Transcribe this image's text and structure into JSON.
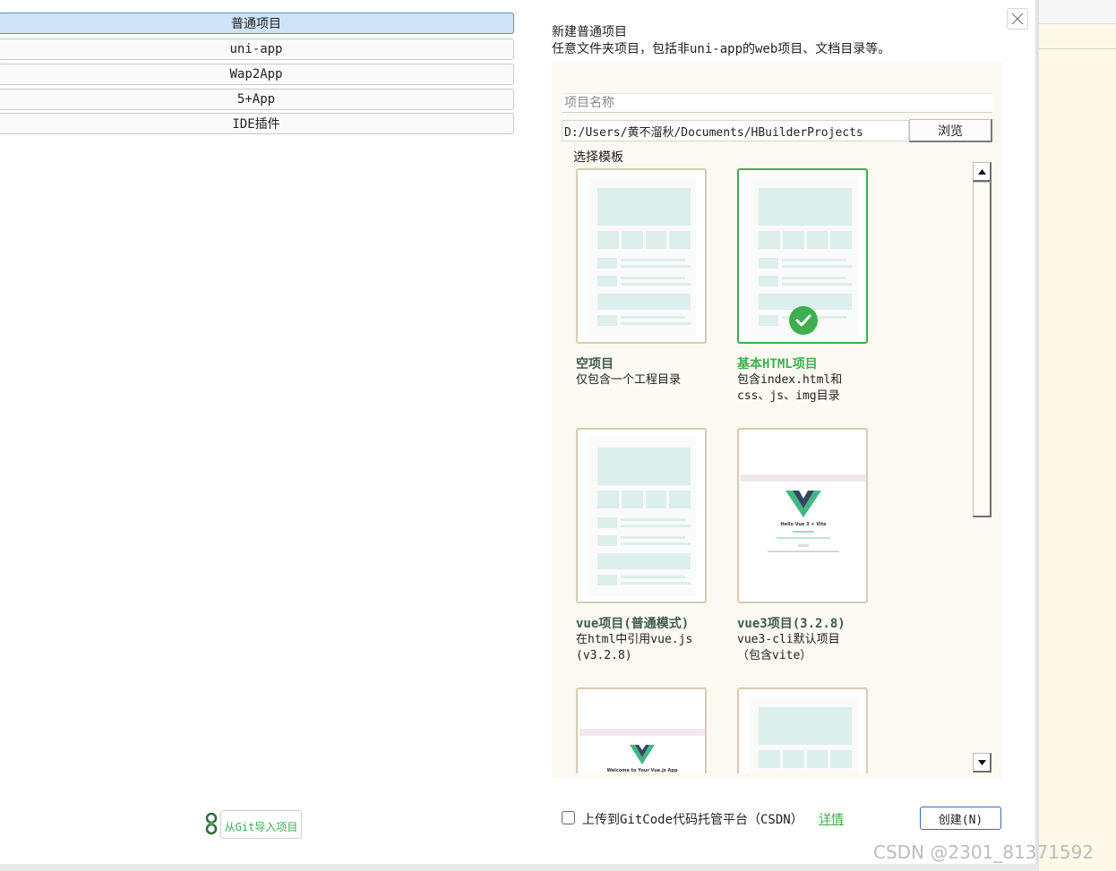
{
  "tabs": [
    {
      "label": "普通项目",
      "active": true
    },
    {
      "label": "uni-app",
      "active": false
    },
    {
      "label": "Wap2App",
      "active": false
    },
    {
      "label": "5+App",
      "active": false
    },
    {
      "label": "IDE插件",
      "active": false
    }
  ],
  "header": {
    "title": "新建普通项目",
    "description": "任意文件夹项目，包括非uni-app的web项目、文档目录等。"
  },
  "form": {
    "name_placeholder": "项目名称",
    "path_value": "D:/Users/黄不溜秋/Documents/HBuilderProjects",
    "browse_label": "浏览",
    "template_label": "选择模板"
  },
  "templates": [
    {
      "title": "空项目",
      "desc": "仅包含一个工程目录",
      "selected": false,
      "icon": "page-layout-icon"
    },
    {
      "title": "基本HTML项目",
      "desc": "包含index.html和\ncss、js、img目录",
      "selected": true,
      "icon": "page-layout-icon"
    },
    {
      "title": "vue项目(普通模式)",
      "desc": "在html中引用vue.js\n(v3.2.8)",
      "selected": false,
      "icon": "page-layout-icon"
    },
    {
      "title": "vue3项目(3.2.8)",
      "desc": "vue3-cli默认项目\n（包含vite）",
      "selected": false,
      "icon": "vue-preview-icon"
    }
  ],
  "vue_preview": {
    "heading": "Hello Vue 3 + Vite",
    "heading2": "Welcome to Your Vue.js App"
  },
  "footer": {
    "upload_label": "上传到GitCode代码托管平台（CSDN）",
    "upload_checked": false,
    "detail_link": "详情",
    "create_label": "创建(N)",
    "git_import_label": "从Git导入项目"
  },
  "watermark": "CSDN @2301_81371592",
  "colors": {
    "accent_green": "#3fae4f",
    "active_tab_bg": "#cfe3f7",
    "card_border": "#d8ccaf",
    "panel_bg": "#fbf9f1",
    "placeholder_block": "#dcefec"
  }
}
